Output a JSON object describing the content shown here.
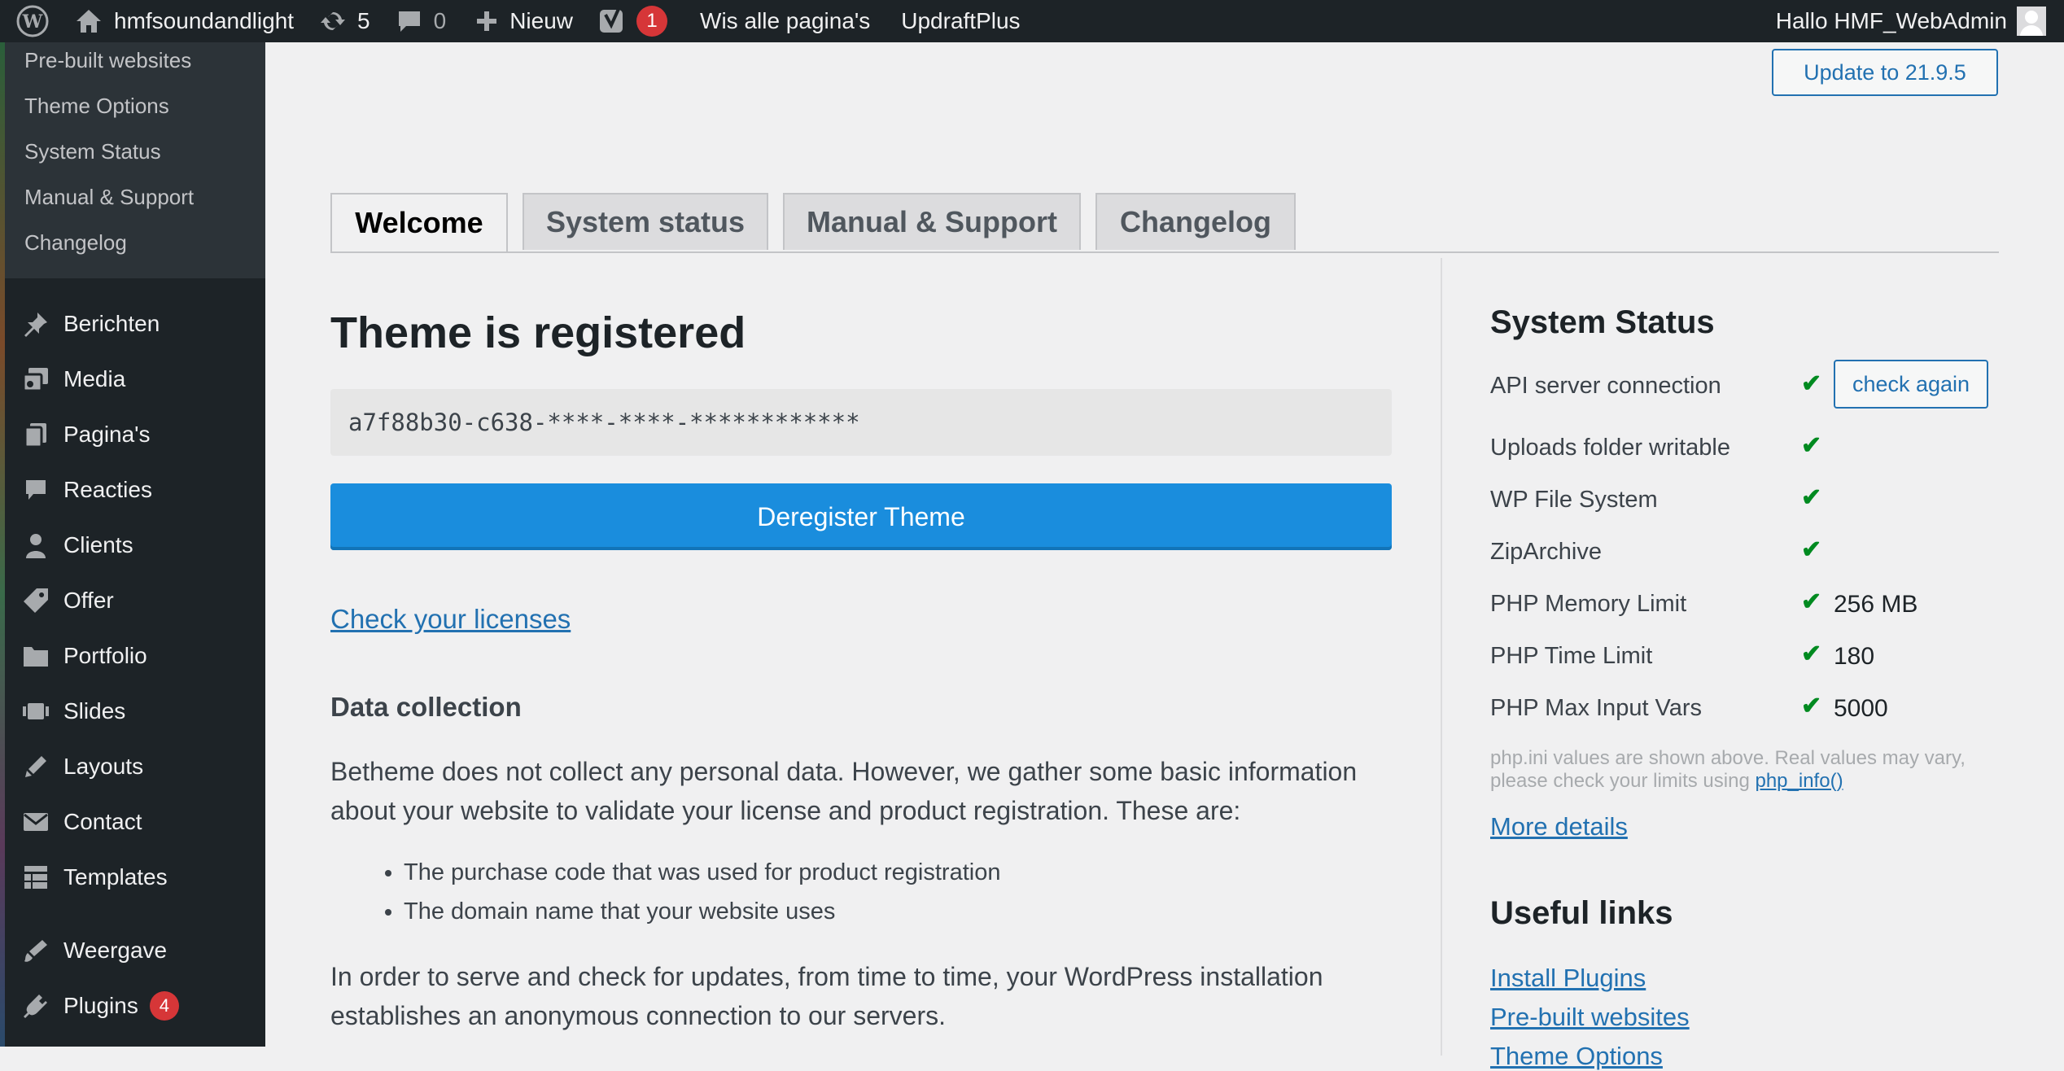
{
  "adminbar": {
    "site_name": "hmfsoundandlight",
    "updates_count": "5",
    "comments_count": "0",
    "new_label": "Nieuw",
    "yoast_badge": "1",
    "clear_cache": "Wis alle pagina's",
    "updraft": "UpdraftPlus",
    "greeting": "Hallo HMF_WebAdmin"
  },
  "sidebar": {
    "submenu": [
      "Pre-built websites",
      "Theme Options",
      "System Status",
      "Manual & Support",
      "Changelog"
    ],
    "items": [
      {
        "label": "Berichten",
        "icon": "pin-icon"
      },
      {
        "label": "Media",
        "icon": "media-icon"
      },
      {
        "label": "Pagina's",
        "icon": "page-icon"
      },
      {
        "label": "Reacties",
        "icon": "comment-icon"
      },
      {
        "label": "Clients",
        "icon": "user-icon"
      },
      {
        "label": "Offer",
        "icon": "tag-icon"
      },
      {
        "label": "Portfolio",
        "icon": "folder-icon"
      },
      {
        "label": "Slides",
        "icon": "slides-icon"
      },
      {
        "label": "Layouts",
        "icon": "brush-icon"
      },
      {
        "label": "Contact",
        "icon": "mail-icon"
      },
      {
        "label": "Templates",
        "icon": "grid-icon"
      },
      {
        "label": "Weergave",
        "icon": "appearance-icon"
      },
      {
        "label": "Plugins",
        "icon": "plugin-icon",
        "badge": "4"
      }
    ]
  },
  "header": {
    "update_button": "Update to 21.9.5"
  },
  "tabs": [
    "Welcome",
    "System status",
    "Manual & Support",
    "Changelog"
  ],
  "registration": {
    "title": "Theme is registered",
    "code": "a7f88b30-c638-****-****-************",
    "deregister_button": "Deregister Theme",
    "check_licenses": "Check your licenses",
    "data_heading": "Data collection",
    "data_intro": "Betheme does not collect any personal data. However, we gather some basic information about your website to validate your license and product registration. These are:",
    "bullets": [
      "The purchase code that was used for product registration",
      "The domain name that your website uses"
    ],
    "data_outro": "In order to serve and check for updates, from time to time, your WordPress installation establishes an anonymous connection to our servers."
  },
  "system_status": {
    "title": "System Status",
    "check_again": "check again",
    "rows": [
      {
        "label": "API server connection",
        "value": ""
      },
      {
        "label": "Uploads folder writable",
        "value": ""
      },
      {
        "label": "WP File System",
        "value": ""
      },
      {
        "label": "ZipArchive",
        "value": ""
      },
      {
        "label": "PHP Memory Limit",
        "value": "256 MB"
      },
      {
        "label": "PHP Time Limit",
        "value": "180"
      },
      {
        "label": "PHP Max Input Vars",
        "value": "5000"
      }
    ],
    "check_mark": "✔",
    "note_text": "php.ini values are shown above. Real values may vary, please check your limits using",
    "note_link": "php_info()",
    "more_details": "More details"
  },
  "useful_links": {
    "title": "Useful links",
    "links": [
      "Install Plugins",
      "Pre-built websites",
      "Theme Options"
    ]
  },
  "colors": {
    "adminbar_bg": "#1d2327",
    "primary_button": "#1a8ddd",
    "link": "#2271b1",
    "check": "#008a20",
    "badge": "#d63638"
  }
}
